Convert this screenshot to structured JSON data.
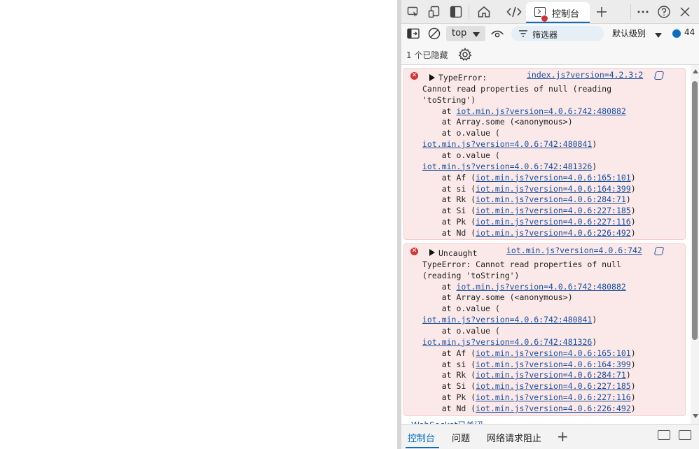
{
  "devtools": {
    "tabs": {
      "active_label": "控制台"
    },
    "toolbar": {
      "context": "top",
      "filter_placeholder": "筛选器",
      "levels_label": "默认级别",
      "message_count": "44"
    },
    "hidden_count_text": "1 个已隐藏",
    "messages": [
      {
        "source": "index.js?version=4.2.3:2",
        "lines": [
          {
            "text": "TypeError:",
            "indent": false
          },
          {
            "text": "Cannot read properties of null (reading",
            "indent": false
          },
          {
            "text": "'toString')",
            "indent": false
          },
          {
            "pre": "    at ",
            "link": "iot.min.js?version=4.0.6:742:480882",
            "post": ""
          },
          {
            "text": "    at Array.some (<anonymous>)",
            "indent": false
          },
          {
            "text": "    at o.value (",
            "indent": false
          },
          {
            "pre": "",
            "link": "iot.min.js?version=4.0.6:742:480841",
            "post": ")"
          },
          {
            "text": "    at o.value (",
            "indent": false
          },
          {
            "pre": "",
            "link": "iot.min.js?version=4.0.6:742:481326",
            "post": ")"
          },
          {
            "pre": "    at Af (",
            "link": "iot.min.js?version=4.0.6:165:101",
            "post": ")"
          },
          {
            "pre": "    at si (",
            "link": "iot.min.js?version=4.0.6:164:399",
            "post": ")"
          },
          {
            "pre": "    at Rk (",
            "link": "iot.min.js?version=4.0.6:284:71",
            "post": ")"
          },
          {
            "pre": "    at Si (",
            "link": "iot.min.js?version=4.0.6:227:185",
            "post": ")"
          },
          {
            "pre": "    at Pk (",
            "link": "iot.min.js?version=4.0.6:227:116",
            "post": ")"
          },
          {
            "pre": "    at Nd (",
            "link": "iot.min.js?version=4.0.6:226:492",
            "post": ")"
          }
        ]
      },
      {
        "source": "iot.min.js?version=4.0.6:742",
        "lines": [
          {
            "text": "Uncaught",
            "indent": false
          },
          {
            "text": "TypeError: Cannot read properties of null",
            "indent": false
          },
          {
            "text": "(reading 'toString')",
            "indent": false
          },
          {
            "pre": "    at ",
            "link": "iot.min.js?version=4.0.6:742:480882",
            "post": ""
          },
          {
            "text": "    at Array.some (<anonymous>)",
            "indent": false
          },
          {
            "text": "    at o.value (",
            "indent": false
          },
          {
            "pre": "",
            "link": "iot.min.js?version=4.0.6:742:480841",
            "post": ")"
          },
          {
            "text": "    at o.value (",
            "indent": false
          },
          {
            "pre": "",
            "link": "iot.min.js?version=4.0.6:742:481326",
            "post": ")"
          },
          {
            "pre": "    at Af (",
            "link": "iot.min.js?version=4.0.6:165:101",
            "post": ")"
          },
          {
            "pre": "    at si (",
            "link": "iot.min.js?version=4.0.6:164:399",
            "post": ")"
          },
          {
            "pre": "    at Rk (",
            "link": "iot.min.js?version=4.0.6:284:71",
            "post": ")"
          },
          {
            "pre": "    at Si (",
            "link": "iot.min.js?version=4.0.6:227:185",
            "post": ")"
          },
          {
            "pre": "    at Pk (",
            "link": "iot.min.js?version=4.0.6:227:116",
            "post": ")"
          },
          {
            "pre": "    at Nd (",
            "link": "iot.min.js?version=4.0.6:226:492",
            "post": ")"
          }
        ]
      }
    ],
    "partial_message": "WebSocket已关闭",
    "drawer_tabs": [
      "控制台",
      "问题",
      "网络请求阻止"
    ]
  }
}
